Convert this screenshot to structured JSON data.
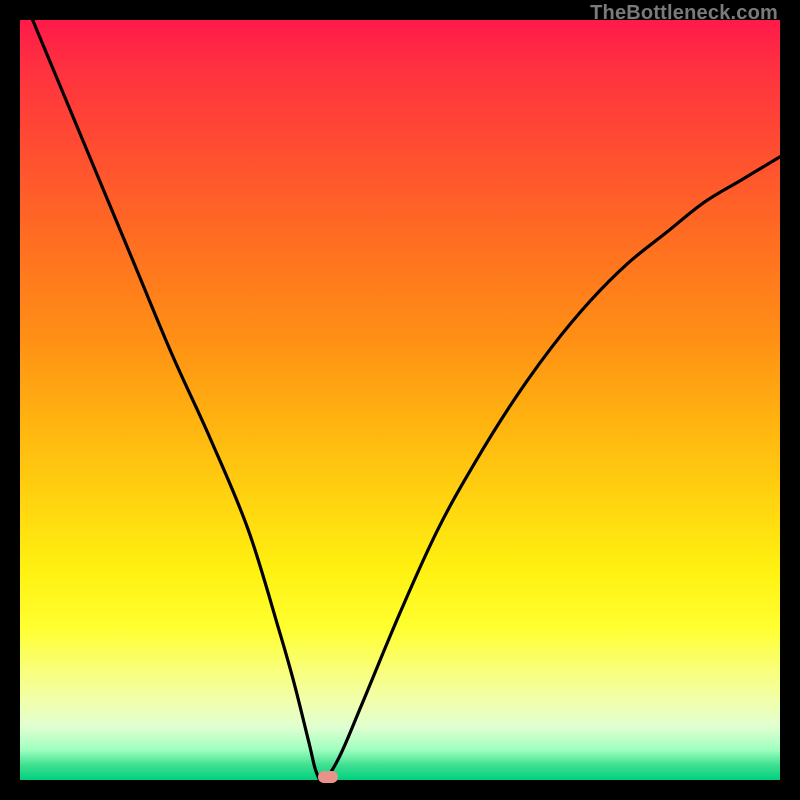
{
  "watermark": "TheBottleneck.com",
  "chart_data": {
    "type": "line",
    "title": "",
    "xlabel": "",
    "ylabel": "",
    "xlim": [
      0,
      100
    ],
    "ylim": [
      0,
      100
    ],
    "series": [
      {
        "name": "bottleneck-curve",
        "x": [
          0,
          5,
          10,
          15,
          20,
          25,
          30,
          34,
          36,
          38,
          39,
          40,
          42,
          45,
          50,
          55,
          60,
          65,
          70,
          75,
          80,
          85,
          90,
          95,
          100
        ],
        "values": [
          104,
          92,
          80,
          68,
          56,
          45,
          33,
          20,
          13,
          5,
          1,
          0,
          3,
          10,
          22,
          33,
          42,
          50,
          57,
          63,
          68,
          72,
          76,
          79,
          82
        ]
      }
    ],
    "marker": {
      "x": 40.5,
      "y": 0.4
    },
    "gradient_stops": [
      {
        "pct": 0,
        "color": "#ff1a4a"
      },
      {
        "pct": 50,
        "color": "#ffb010"
      },
      {
        "pct": 80,
        "color": "#ffff30"
      },
      {
        "pct": 100,
        "color": "#00d080"
      }
    ]
  }
}
